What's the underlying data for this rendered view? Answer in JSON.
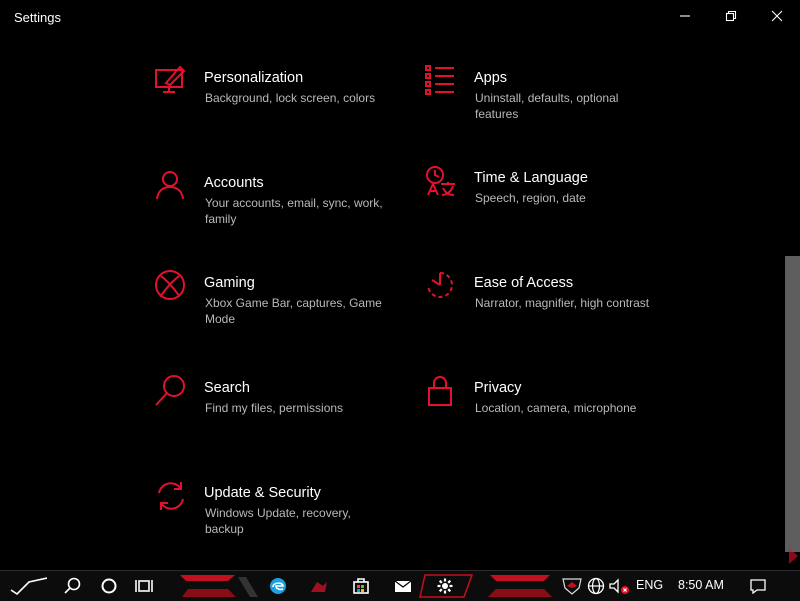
{
  "window": {
    "title": "Settings"
  },
  "colors": {
    "accent": "#e3112d",
    "background": "#000000",
    "description": "#b9b9b9",
    "taskbar": "#0c0c0c"
  },
  "tiles": [
    {
      "title": "Personalization",
      "desc": "Background, lock screen, colors",
      "icon": "personalization-icon"
    },
    {
      "title": "Apps",
      "desc": "Uninstall, defaults, optional features",
      "icon": "apps-icon"
    },
    {
      "title": "Accounts",
      "desc": "Your accounts, email, sync, work, family",
      "icon": "accounts-icon"
    },
    {
      "title": "Time & Language",
      "desc": "Speech, region, date",
      "icon": "time-language-icon"
    },
    {
      "title": "Gaming",
      "desc": "Xbox Game Bar, captures, Game Mode",
      "icon": "xbox-icon"
    },
    {
      "title": "Ease of Access",
      "desc": "Narrator, magnifier, high contrast",
      "icon": "ease-of-access-icon"
    },
    {
      "title": "Search",
      "desc": "Find my files, permissions",
      "icon": "search-icon"
    },
    {
      "title": "Privacy",
      "desc": "Location, camera, microphone",
      "icon": "lock-icon"
    },
    {
      "title": "Update & Security",
      "desc": "Windows Update, recovery, backup",
      "icon": "sync-icon"
    }
  ],
  "taskbar": {
    "language": "ENG",
    "time": "8:50 AM",
    "icons": [
      "start-icon",
      "search-icon",
      "cortana-icon",
      "task-view-icon",
      "edge-icon",
      "armoury-icon",
      "store-icon",
      "mail-icon",
      "settings-icon",
      "rog-icon",
      "network-icon",
      "volume-icon",
      "notifications-icon"
    ]
  }
}
